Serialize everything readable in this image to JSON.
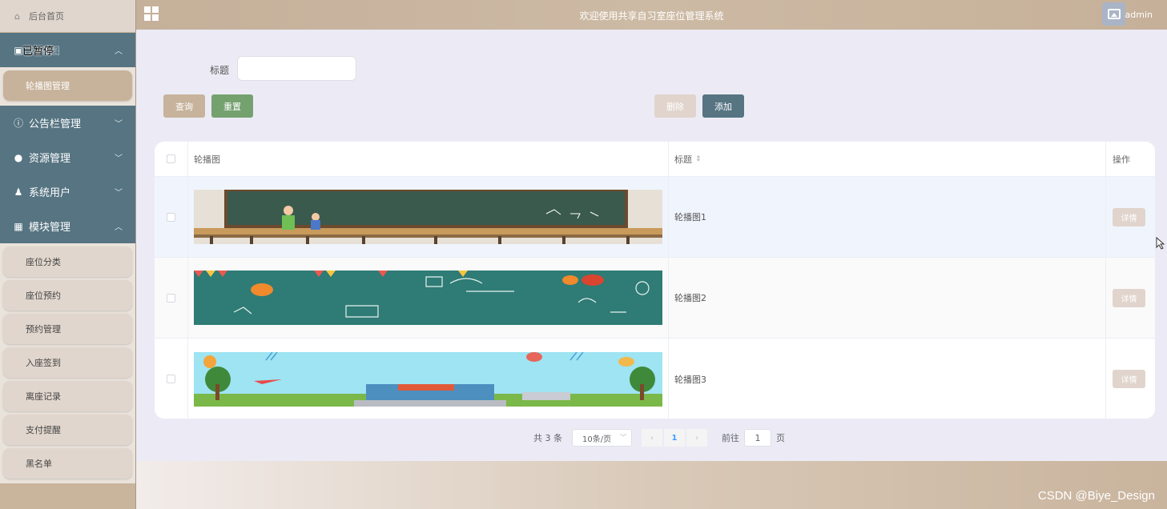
{
  "sidebar": {
    "home_label": "后台首页",
    "menus": [
      {
        "label": "轮播图",
        "overlay": "已暂停",
        "icon": "image-icon",
        "arrow": "⌃"
      },
      {
        "label": "公告栏管理",
        "icon": "info-icon",
        "arrow": "⌄"
      },
      {
        "label": "资源管理",
        "icon": "bulb-icon",
        "arrow": "⌄"
      },
      {
        "label": "系统用户",
        "icon": "user-icon",
        "arrow": "⌄"
      },
      {
        "label": "模块管理",
        "icon": "grid-icon",
        "arrow": "⌃"
      }
    ],
    "carousel_items": [
      "轮播图管理"
    ],
    "module_items": [
      "座位分类",
      "座位预约",
      "预约管理",
      "入座签到",
      "离座记录",
      "支付提醒",
      "黑名单"
    ]
  },
  "header": {
    "title": "欢迎使用共享自习室座位管理系统",
    "username": "admin"
  },
  "search": {
    "label": "标题",
    "value": "",
    "query_label": "查询",
    "reset_label": "重置",
    "delete_label": "删除",
    "add_label": "添加"
  },
  "table": {
    "columns": {
      "image": "轮播图",
      "title": "标题",
      "sort_icon": "⇕",
      "op": "操作"
    },
    "rows": [
      {
        "title": "轮播图1",
        "detail": "详情"
      },
      {
        "title": "轮播图2",
        "detail": "详情"
      },
      {
        "title": "轮播图3",
        "detail": "详情"
      }
    ]
  },
  "pager": {
    "total": "共 3 条",
    "size": "10条/页",
    "prev": "‹",
    "page": "1",
    "next": "›",
    "goto": "前往",
    "goto_value": "1",
    "unit": "页"
  },
  "watermark": "CSDN @Biye_Design",
  "colors": {
    "sidebar_menu": "#567482",
    "accent": "#c7b39b",
    "reset": "#75a16f"
  }
}
